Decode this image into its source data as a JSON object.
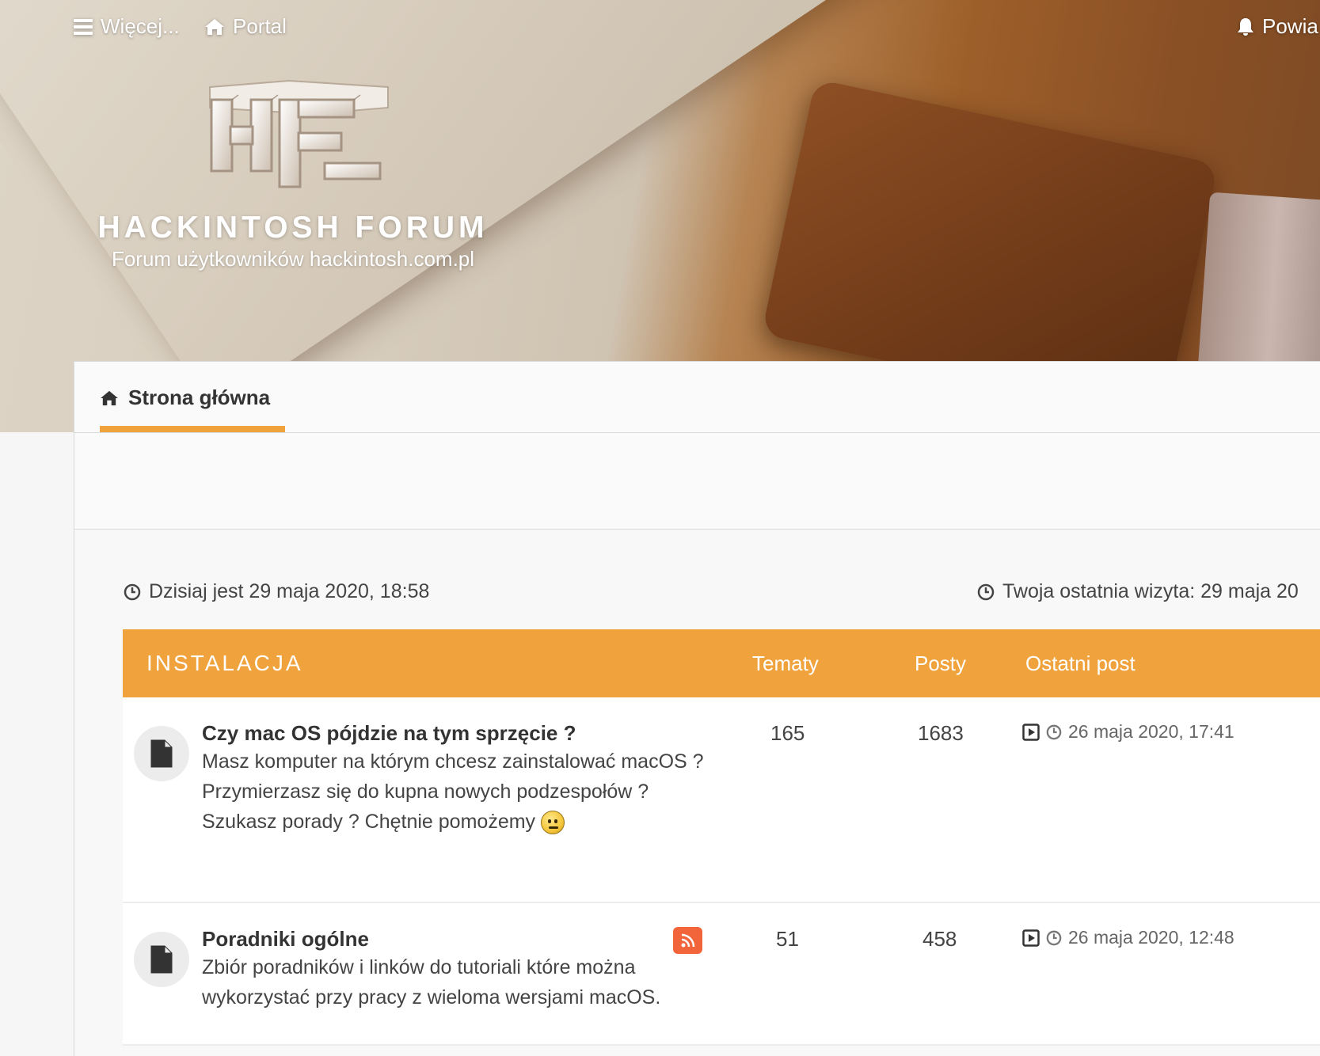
{
  "header": {
    "more_label": "Więcej...",
    "portal_label": "Portal",
    "notifications_label": "Powia",
    "site_title": "HACKINTOSH FORUM",
    "site_description": "Forum użytkowników hackintosh.com.pl",
    "logo_text": "HF"
  },
  "breadcrumb": {
    "home_label": "Strona główna"
  },
  "info": {
    "current_time": "Dzisiaj jest 29 maja 2020, 18:58",
    "last_visit": "Twoja ostatnia wizyta: 29 maja 20"
  },
  "forum_section": {
    "category": "INSTALACJA",
    "columns": {
      "topics": "Tematy",
      "posts": "Posty",
      "last_post": "Ostatni post"
    },
    "forums": [
      {
        "title": "Czy mac OS pójdzie na tym sprzęcie ?",
        "description": "Masz komputer na którym chcesz zainstalować macOS ? Przymierzasz się do kupna nowych podzespołów ? Szukasz porady ? Chętnie pomożemy",
        "topics": "165",
        "posts": "1683",
        "last_post_time": "26 maja 2020, 17:41"
      },
      {
        "title": "Poradniki ogólne",
        "description": "Zbiór poradników i linków do tutoriali które można wykorzystać przy pracy z wieloma wersjami macOS.",
        "topics": "51",
        "posts": "458",
        "last_post_time": "26 maja 2020, 12:48"
      }
    ]
  },
  "colors": {
    "accent": "#f0a23c",
    "rss": "#f2653a"
  },
  "icons": {
    "menu": "bars-icon",
    "home": "home-icon",
    "bell": "bell-icon",
    "clock": "clock-icon",
    "file": "file-icon",
    "goto": "play-square-icon",
    "rss": "rss-icon"
  }
}
